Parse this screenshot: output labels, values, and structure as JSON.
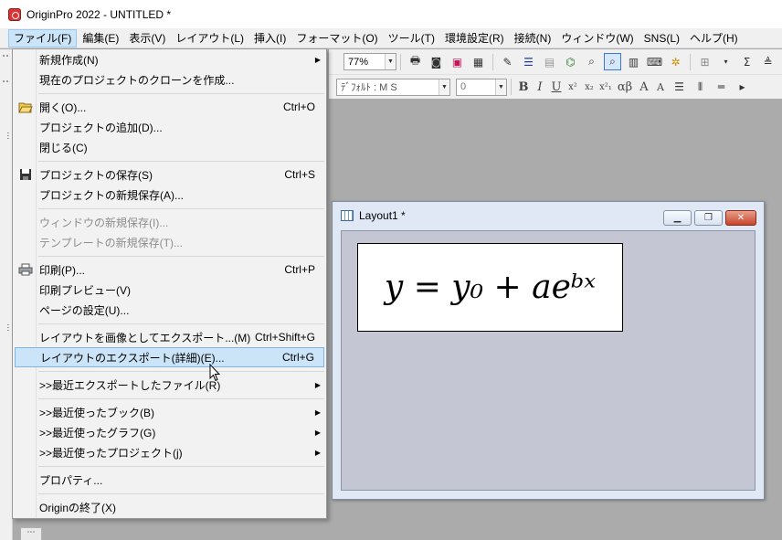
{
  "window": {
    "title": "OriginPro 2022 - UNTITLED *"
  },
  "menubar": {
    "items": [
      "ファイル(F)",
      "編集(E)",
      "表示(V)",
      "レイアウト(L)",
      "挿入(I)",
      "フォーマット(O)",
      "ツール(T)",
      "環境設定(R)",
      "接続(N)",
      "ウィンドウ(W)",
      "SNS(L)",
      "ヘルプ(H)"
    ]
  },
  "toolbar": {
    "zoom": "77%",
    "font": "ﾃﾞﾌｫﾙﾄ : M S",
    "font_size": "0",
    "format_buttons": [
      "B",
      "I",
      "U",
      "x²",
      "x₂",
      "x²₁",
      "αβ",
      "A",
      "A"
    ]
  },
  "file_menu": {
    "items": [
      {
        "label": "新規作成(N)",
        "shortcut": "",
        "submenu": true,
        "disabled": false,
        "icon": ""
      },
      {
        "label": "現在のプロジェクトのクローンを作成...",
        "shortcut": "",
        "submenu": false,
        "disabled": false,
        "icon": ""
      },
      {
        "label": "開く(O)...",
        "shortcut": "Ctrl+O",
        "submenu": false,
        "disabled": false,
        "icon": "open-folder-icon"
      },
      {
        "label": "プロジェクトの追加(D)...",
        "shortcut": "",
        "submenu": false,
        "disabled": false,
        "icon": ""
      },
      {
        "label": "閉じる(C)",
        "shortcut": "",
        "submenu": false,
        "disabled": false,
        "icon": ""
      },
      {
        "label": "プロジェクトの保存(S)",
        "shortcut": "Ctrl+S",
        "submenu": false,
        "disabled": false,
        "icon": "save-icon"
      },
      {
        "label": "プロジェクトの新規保存(A)...",
        "shortcut": "",
        "submenu": false,
        "disabled": false,
        "icon": ""
      },
      {
        "label": "ウィンドウの新規保存(I)...",
        "shortcut": "",
        "submenu": false,
        "disabled": true,
        "icon": ""
      },
      {
        "label": "テンプレートの新規保存(T)...",
        "shortcut": "",
        "submenu": false,
        "disabled": true,
        "icon": ""
      },
      {
        "label": "印刷(P)...",
        "shortcut": "Ctrl+P",
        "submenu": false,
        "disabled": false,
        "icon": "printer-icon"
      },
      {
        "label": "印刷プレビュー(V)",
        "shortcut": "",
        "submenu": false,
        "disabled": false,
        "icon": ""
      },
      {
        "label": "ページの設定(U)...",
        "shortcut": "",
        "submenu": false,
        "disabled": false,
        "icon": ""
      },
      {
        "label": "レイアウトを画像としてエクスポート...(M)",
        "shortcut": "Ctrl+Shift+G",
        "submenu": false,
        "disabled": false,
        "icon": ""
      },
      {
        "label": "レイアウトのエクスポート(詳細)(E)...",
        "shortcut": "Ctrl+G",
        "submenu": false,
        "disabled": false,
        "icon": "",
        "highlighted": true
      },
      {
        "label": ">>最近エクスポートしたファイル(R)",
        "shortcut": "",
        "submenu": true,
        "disabled": false,
        "icon": ""
      },
      {
        "label": ">>最近使ったブック(B)",
        "shortcut": "",
        "submenu": true,
        "disabled": false,
        "icon": ""
      },
      {
        "label": ">>最近使ったグラフ(G)",
        "shortcut": "",
        "submenu": true,
        "disabled": false,
        "icon": ""
      },
      {
        "label": ">>最近使ったプロジェクト(j)",
        "shortcut": "",
        "submenu": true,
        "disabled": false,
        "icon": ""
      },
      {
        "label": "プロパティ...",
        "shortcut": "",
        "submenu": false,
        "disabled": false,
        "icon": ""
      },
      {
        "label": "Originの終了(X)",
        "shortcut": "",
        "submenu": false,
        "disabled": false,
        "icon": ""
      }
    ]
  },
  "layout_window": {
    "title": "Layout1 *",
    "equation": "y = y₀ + aeᵇˣ"
  }
}
